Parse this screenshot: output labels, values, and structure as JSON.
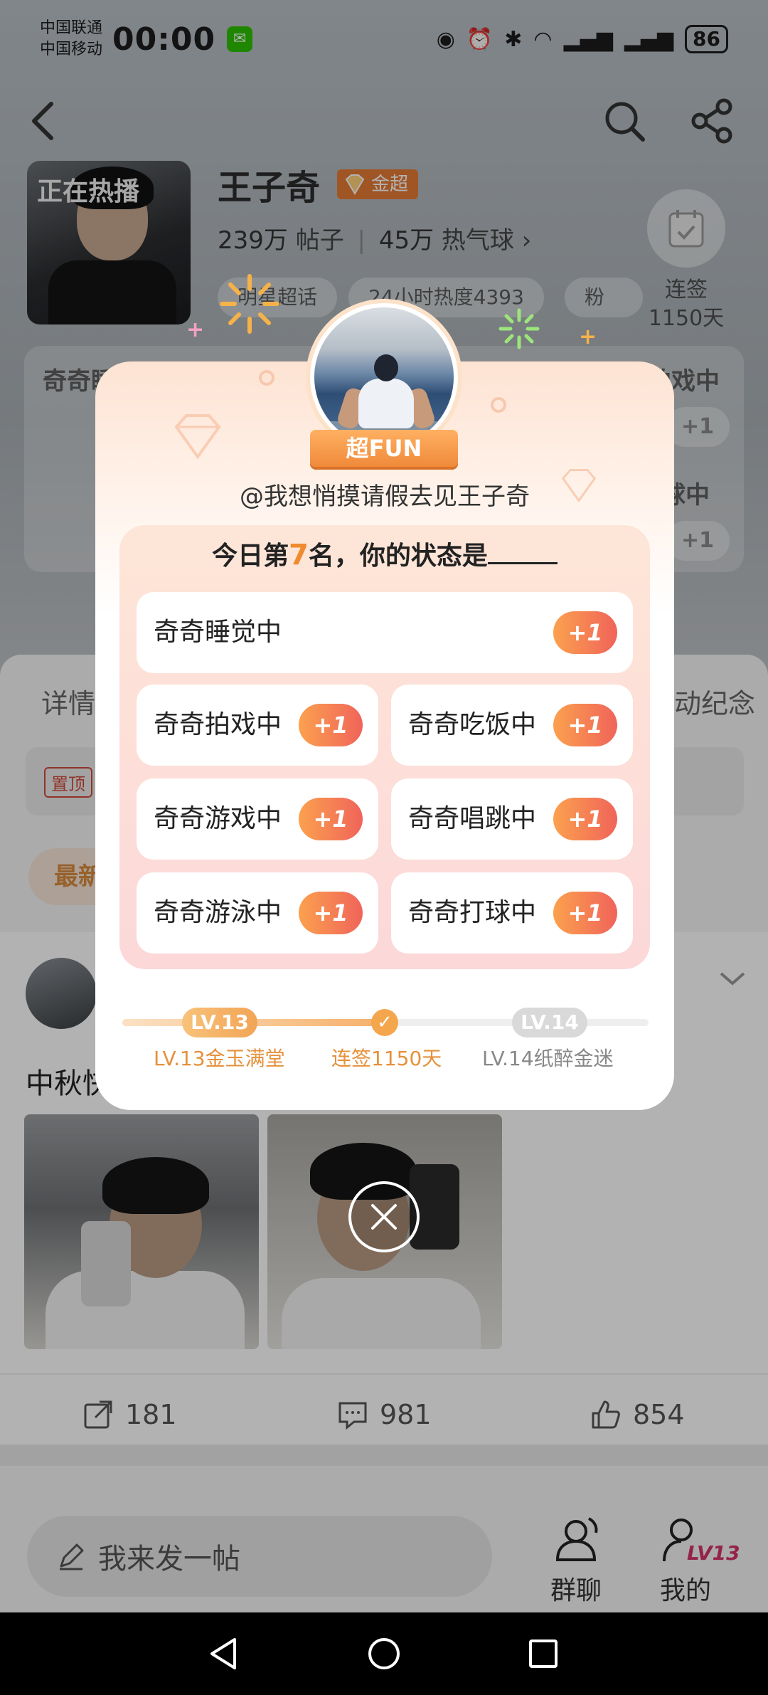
{
  "status_bar": {
    "carrier_1": "中国联通",
    "carrier_2": "中国移动",
    "time": "00:00",
    "battery": "86"
  },
  "header": {
    "star_name": "王子奇",
    "badge": "金超",
    "posts_count": "239万",
    "posts_label": "帖子",
    "balloon_count": "45万",
    "balloon_label": "热气球",
    "tags": [
      "明星超话",
      "24小时热度4393",
      "粉丝"
    ],
    "signin_label_1": "连签",
    "signin_label_2": "1150天",
    "cover_tagline": "正在热播"
  },
  "background_statuses": [
    "奇奇睡",
    "拍戏中",
    "球中"
  ],
  "background_tabs": {
    "details": "详情",
    "anniversary": "动纪念"
  },
  "pinned_label": "置顶",
  "latest_label": "最新",
  "post": {
    "text": "中秋快",
    "shares": "181",
    "comments": "981",
    "likes": "854"
  },
  "bottom_bar": {
    "compose_label": "我来发一帖",
    "group_chat_label": "群聊",
    "mine_label": "我的",
    "mine_level": "LV13"
  },
  "modal": {
    "ribbon": "超FUN",
    "user": "@我想悄摸请假去见王子奇",
    "question_prefix": "今日第",
    "rank": "7",
    "question_suffix": "名，你的状态是",
    "options": [
      {
        "label": "奇奇睡觉中",
        "plus": "+1"
      },
      {
        "label": "奇奇拍戏中",
        "plus": "+1"
      },
      {
        "label": "奇奇吃饭中",
        "plus": "+1"
      },
      {
        "label": "奇奇游戏中",
        "plus": "+1"
      },
      {
        "label": "奇奇唱跳中",
        "plus": "+1"
      },
      {
        "label": "奇奇游泳中",
        "plus": "+1"
      },
      {
        "label": "奇奇打球中",
        "plus": "+1"
      }
    ],
    "level_current": "LV.13",
    "level_next": "LV.14",
    "level_current_text": "LV.13金玉满堂",
    "streak_text": "连签1150天",
    "level_next_text": "LV.14纸醉金迷",
    "level_progress_pct": 50
  },
  "colors": {
    "accent_orange": "#f08a2e",
    "plus_gradient_start": "#fba14e",
    "plus_gradient_end": "#f0645a",
    "badge_orange": "#e57a34"
  }
}
